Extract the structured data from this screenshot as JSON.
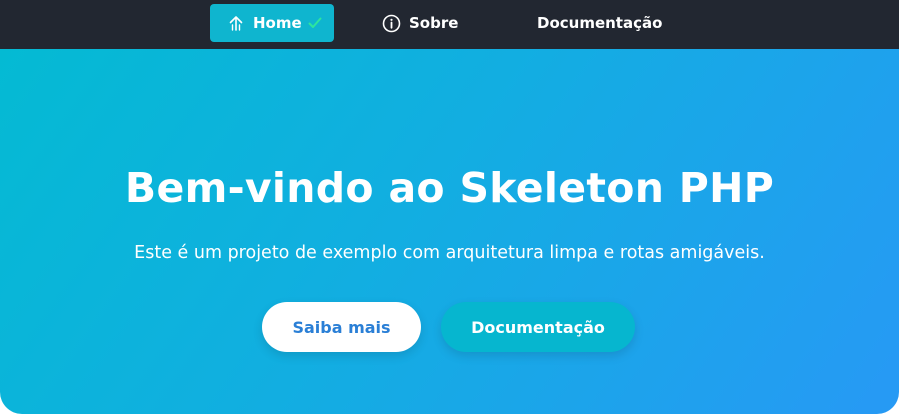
{
  "navbar": {
    "items": [
      {
        "label": "Home",
        "icon": "arrow-up-icon",
        "active": true,
        "badge_icon": "check-icon"
      },
      {
        "label": "Sobre",
        "icon": "info-circle-icon",
        "active": false
      },
      {
        "label": "Documentação",
        "active": false
      }
    ]
  },
  "hero": {
    "title": "Bem-vindo ao Skeleton PHP",
    "subtitle": "Este é um projeto de exemplo com arquitetura limpa e rotas amigáveis.",
    "primary_button": "Saiba mais",
    "secondary_button": "Documentação"
  },
  "colors": {
    "navbar_bg": "#222731",
    "active_nav_bg": "#0fb5cf",
    "check_color": "#2ee59d",
    "hero_gradient_start": "#04bad3",
    "hero_gradient_end": "#2799f5",
    "primary_button_text": "#2a7fd6",
    "secondary_button_bg": "#06b6cf"
  }
}
